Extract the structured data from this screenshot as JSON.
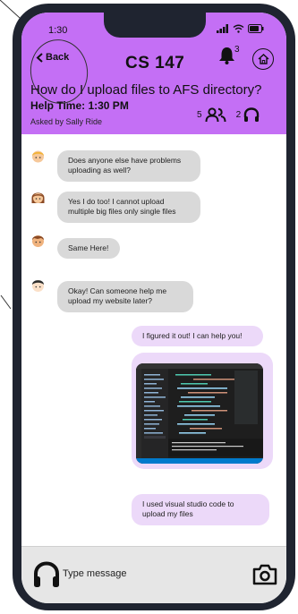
{
  "status_bar": {
    "time": "1:30"
  },
  "header": {
    "back_label": "Back",
    "course_title": "CS 147",
    "notification_count": "3",
    "question_title": "How do I upload files to AFS directory?",
    "help_time": "Help Time: 1:30 PM",
    "asked_by": "Asked by Sally Ride",
    "people_count": "5",
    "listener_count": "2"
  },
  "messages": [
    {
      "side": "left",
      "text": "Does anyone else have problems uploading as well?"
    },
    {
      "side": "left",
      "text": "Yes I do too! I cannot upload multiple big files only single files"
    },
    {
      "side": "left",
      "text": "Same Here!"
    },
    {
      "side": "left",
      "text": "Okay! Can someone help me upload my website later?"
    },
    {
      "side": "right",
      "text": "I figured it out! I can help you!"
    },
    {
      "side": "right",
      "text": "I used visual studio code to upload my files"
    }
  ],
  "composer": {
    "placeholder": "Type message"
  },
  "colors": {
    "header": "#c46ff5",
    "bubble_left": "#d9d9d9",
    "bubble_right": "#ecd9f9",
    "phone_frame": "#1f2430"
  }
}
